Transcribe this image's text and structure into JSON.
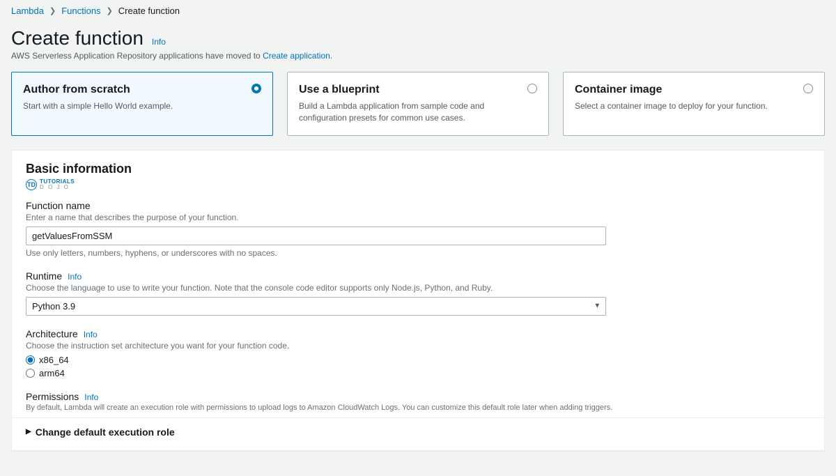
{
  "breadcrumb": {
    "lambda": "Lambda",
    "functions": "Functions",
    "current": "Create function"
  },
  "header": {
    "title": "Create function",
    "info": "Info",
    "subtext_prefix": "AWS Serverless Application Repository applications have moved to ",
    "subtext_link": "Create application",
    "subtext_suffix": "."
  },
  "options": [
    {
      "title": "Author from scratch",
      "desc": "Start with a simple Hello World example."
    },
    {
      "title": "Use a blueprint",
      "desc": "Build a Lambda application from sample code and configuration presets for common use cases."
    },
    {
      "title": "Container image",
      "desc": "Select a container image to deploy for your function."
    }
  ],
  "basic": {
    "panel_title": "Basic information",
    "watermark_top": "TUTORIALS",
    "watermark_bot": "D O J O",
    "function_name": {
      "label": "Function name",
      "desc": "Enter a name that describes the purpose of your function.",
      "value": "getValuesFromSSM",
      "hint": "Use only letters, numbers, hyphens, or underscores with no spaces."
    },
    "runtime": {
      "label": "Runtime",
      "info": "Info",
      "desc": "Choose the language to use to write your function. Note that the console code editor supports only Node.js, Python, and Ruby.",
      "value": "Python 3.9"
    },
    "architecture": {
      "label": "Architecture",
      "info": "Info",
      "desc": "Choose the instruction set architecture you want for your function code.",
      "options": [
        "x86_64",
        "arm64"
      ]
    },
    "permissions": {
      "label": "Permissions",
      "info": "Info",
      "desc": "By default, Lambda will create an execution role with permissions to upload logs to Amazon CloudWatch Logs. You can customize this default role later when adding triggers."
    },
    "expander": "Change default execution role"
  }
}
